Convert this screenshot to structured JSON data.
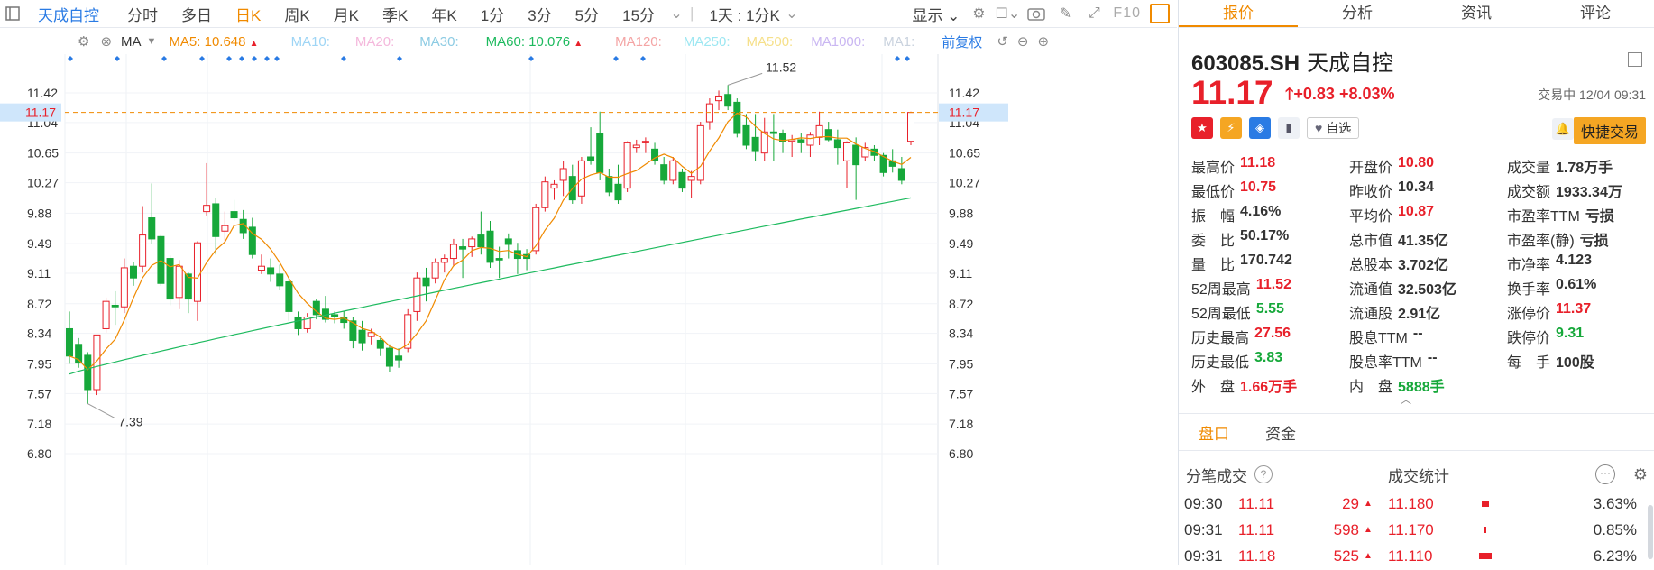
{
  "toolbar": {
    "stock_name": "天成自控",
    "periods": [
      "分时",
      "多日",
      "日K",
      "周K",
      "月K",
      "季K",
      "年K",
      "1分",
      "3分",
      "5分",
      "15分"
    ],
    "active_period": "日K",
    "combo": "1天 : 1分K",
    "display": "显示",
    "f10": "F10"
  },
  "ma_bar": {
    "ma_label": "MA",
    "ma5": "MA5: 10.648",
    "ma10": "MA10:",
    "ma20": "MA20:",
    "ma30": "MA30:",
    "ma60": "MA60: 10.076",
    "ma120": "MA120:",
    "ma250": "MA250:",
    "ma500": "MA500:",
    "ma1000": "MA1000:",
    "ma1": "MA1:",
    "adjust": "前复权"
  },
  "chart": {
    "y_ticks": [
      "11.42",
      "11.04",
      "10.65",
      "10.27",
      "9.88",
      "9.49",
      "9.11",
      "8.72",
      "8.34",
      "7.95",
      "7.57",
      "7.18",
      "6.80"
    ],
    "current_price": "11.17",
    "high_label": "11.52",
    "low_label": "7.39",
    "ylim": [
      6.8,
      11.42
    ],
    "colors": {
      "up": "#e8202a",
      "down": "#16a83a",
      "ma5": "#f08a00",
      "ma60": "#1dba5e",
      "dash": "#f08a00",
      "marker": "#2a7be4"
    }
  },
  "chart_data": {
    "type": "candlestick",
    "ylim": [
      6.8,
      11.42
    ],
    "candles": [
      {
        "o": 8.4,
        "h": 8.62,
        "l": 7.95,
        "c": 8.05
      },
      {
        "o": 8.2,
        "h": 8.28,
        "l": 7.9,
        "c": 7.96
      },
      {
        "o": 8.06,
        "h": 8.1,
        "l": 7.44,
        "c": 7.62
      },
      {
        "o": 7.62,
        "h": 8.32,
        "l": 7.55,
        "c": 8.32
      },
      {
        "o": 8.4,
        "h": 8.8,
        "l": 8.35,
        "c": 8.75
      },
      {
        "o": 8.7,
        "h": 8.88,
        "l": 8.45,
        "c": 8.68
      },
      {
        "o": 8.68,
        "h": 9.3,
        "l": 8.6,
        "c": 9.18
      },
      {
        "o": 9.2,
        "h": 9.26,
        "l": 8.95,
        "c": 9.05
      },
      {
        "o": 9.2,
        "h": 9.97,
        "l": 9.12,
        "c": 9.6
      },
      {
        "o": 9.82,
        "h": 10.26,
        "l": 9.48,
        "c": 9.55
      },
      {
        "o": 9.58,
        "h": 9.6,
        "l": 8.95,
        "c": 8.98
      },
      {
        "o": 9.3,
        "h": 9.34,
        "l": 8.7,
        "c": 8.78
      },
      {
        "o": 8.8,
        "h": 9.28,
        "l": 8.65,
        "c": 9.2
      },
      {
        "o": 9.1,
        "h": 9.12,
        "l": 8.6,
        "c": 8.78
      },
      {
        "o": 8.75,
        "h": 9.52,
        "l": 8.5,
        "c": 9.5
      },
      {
        "o": 9.9,
        "h": 10.52,
        "l": 9.85,
        "c": 9.98
      },
      {
        "o": 10.0,
        "h": 10.08,
        "l": 9.35,
        "c": 9.58
      },
      {
        "o": 9.65,
        "h": 9.9,
        "l": 9.5,
        "c": 9.72
      },
      {
        "o": 9.9,
        "h": 10.05,
        "l": 9.78,
        "c": 9.82
      },
      {
        "o": 9.8,
        "h": 9.92,
        "l": 9.55,
        "c": 9.63
      },
      {
        "o": 9.7,
        "h": 9.82,
        "l": 9.3,
        "c": 9.35
      },
      {
        "o": 9.15,
        "h": 9.35,
        "l": 9.1,
        "c": 9.2
      },
      {
        "o": 9.18,
        "h": 9.3,
        "l": 9.0,
        "c": 9.1
      },
      {
        "o": 9.1,
        "h": 9.22,
        "l": 8.9,
        "c": 8.95
      },
      {
        "o": 9.0,
        "h": 9.05,
        "l": 8.5,
        "c": 8.62
      },
      {
        "o": 8.55,
        "h": 8.62,
        "l": 8.32,
        "c": 8.4
      },
      {
        "o": 8.4,
        "h": 8.6,
        "l": 8.35,
        "c": 8.55
      },
      {
        "o": 8.75,
        "h": 8.78,
        "l": 8.52,
        "c": 8.58
      },
      {
        "o": 8.65,
        "h": 8.82,
        "l": 8.48,
        "c": 8.52
      },
      {
        "o": 8.58,
        "h": 8.62,
        "l": 8.47,
        "c": 8.55
      },
      {
        "o": 8.55,
        "h": 8.62,
        "l": 8.4,
        "c": 8.48
      },
      {
        "o": 8.5,
        "h": 8.55,
        "l": 8.15,
        "c": 8.25
      },
      {
        "o": 8.38,
        "h": 8.5,
        "l": 8.12,
        "c": 8.22
      },
      {
        "o": 8.3,
        "h": 8.4,
        "l": 8.2,
        "c": 8.35
      },
      {
        "o": 8.25,
        "h": 8.28,
        "l": 8.05,
        "c": 8.15
      },
      {
        "o": 8.15,
        "h": 8.2,
        "l": 7.85,
        "c": 7.92
      },
      {
        "o": 8.05,
        "h": 8.15,
        "l": 7.9,
        "c": 8.0
      },
      {
        "o": 8.15,
        "h": 8.65,
        "l": 8.1,
        "c": 8.58
      },
      {
        "o": 8.62,
        "h": 9.12,
        "l": 8.5,
        "c": 9.05
      },
      {
        "o": 9.05,
        "h": 9.18,
        "l": 8.75,
        "c": 8.95
      },
      {
        "o": 9.05,
        "h": 9.3,
        "l": 8.98,
        "c": 9.25
      },
      {
        "o": 9.25,
        "h": 9.35,
        "l": 9.12,
        "c": 9.3
      },
      {
        "o": 9.3,
        "h": 9.55,
        "l": 9.2,
        "c": 9.48
      },
      {
        "o": 9.45,
        "h": 9.55,
        "l": 9.05,
        "c": 9.42
      },
      {
        "o": 9.45,
        "h": 9.58,
        "l": 9.32,
        "c": 9.55
      },
      {
        "o": 9.6,
        "h": 9.9,
        "l": 9.35,
        "c": 9.45
      },
      {
        "o": 9.65,
        "h": 9.78,
        "l": 9.18,
        "c": 9.25
      },
      {
        "o": 9.3,
        "h": 9.45,
        "l": 9.05,
        "c": 9.28
      },
      {
        "o": 9.55,
        "h": 9.62,
        "l": 9.3,
        "c": 9.48
      },
      {
        "o": 9.4,
        "h": 9.5,
        "l": 9.1,
        "c": 9.3
      },
      {
        "o": 9.35,
        "h": 9.42,
        "l": 9.15,
        "c": 9.3
      },
      {
        "o": 9.4,
        "h": 10.0,
        "l": 9.35,
        "c": 9.95
      },
      {
        "o": 9.95,
        "h": 10.35,
        "l": 9.9,
        "c": 10.28
      },
      {
        "o": 10.2,
        "h": 10.3,
        "l": 10.05,
        "c": 10.25
      },
      {
        "o": 10.3,
        "h": 10.55,
        "l": 10.1,
        "c": 10.45
      },
      {
        "o": 10.35,
        "h": 10.5,
        "l": 10.0,
        "c": 10.05
      },
      {
        "o": 10.1,
        "h": 10.6,
        "l": 10.0,
        "c": 10.55
      },
      {
        "o": 10.6,
        "h": 10.98,
        "l": 10.5,
        "c": 10.55
      },
      {
        "o": 10.9,
        "h": 11.18,
        "l": 10.3,
        "c": 10.4
      },
      {
        "o": 10.35,
        "h": 10.45,
        "l": 10.1,
        "c": 10.15
      },
      {
        "o": 10.25,
        "h": 10.5,
        "l": 10.0,
        "c": 10.05
      },
      {
        "o": 10.2,
        "h": 10.8,
        "l": 10.15,
        "c": 10.78
      },
      {
        "o": 10.72,
        "h": 10.82,
        "l": 10.65,
        "c": 10.75
      },
      {
        "o": 10.78,
        "h": 10.85,
        "l": 10.65,
        "c": 10.8
      },
      {
        "o": 10.7,
        "h": 10.78,
        "l": 10.5,
        "c": 10.55
      },
      {
        "o": 10.5,
        "h": 10.6,
        "l": 10.25,
        "c": 10.3
      },
      {
        "o": 10.3,
        "h": 10.6,
        "l": 10.25,
        "c": 10.55
      },
      {
        "o": 10.4,
        "h": 10.45,
        "l": 10.15,
        "c": 10.2
      },
      {
        "o": 10.3,
        "h": 10.42,
        "l": 10.08,
        "c": 10.35
      },
      {
        "o": 10.3,
        "h": 11.05,
        "l": 10.25,
        "c": 11.0
      },
      {
        "o": 11.05,
        "h": 11.35,
        "l": 10.95,
        "c": 11.28
      },
      {
        "o": 11.32,
        "h": 11.45,
        "l": 11.2,
        "c": 11.38
      },
      {
        "o": 11.4,
        "h": 11.52,
        "l": 11.2,
        "c": 11.25
      },
      {
        "o": 11.3,
        "h": 11.35,
        "l": 10.85,
        "c": 10.9
      },
      {
        "o": 11.0,
        "h": 11.15,
        "l": 10.7,
        "c": 10.75
      },
      {
        "o": 10.85,
        "h": 11.15,
        "l": 10.55,
        "c": 10.68
      },
      {
        "o": 10.65,
        "h": 11.1,
        "l": 10.55,
        "c": 10.92
      },
      {
        "o": 10.92,
        "h": 11.15,
        "l": 10.55,
        "c": 10.9
      },
      {
        "o": 10.9,
        "h": 10.95,
        "l": 10.65,
        "c": 10.8
      },
      {
        "o": 10.8,
        "h": 10.88,
        "l": 10.6,
        "c": 10.82
      },
      {
        "o": 10.82,
        "h": 10.9,
        "l": 10.65,
        "c": 10.78
      },
      {
        "o": 10.75,
        "h": 10.92,
        "l": 10.6,
        "c": 10.88
      },
      {
        "o": 10.85,
        "h": 11.18,
        "l": 10.75,
        "c": 11.0
      },
      {
        "o": 10.95,
        "h": 11.05,
        "l": 10.8,
        "c": 10.82
      },
      {
        "o": 10.82,
        "h": 10.95,
        "l": 10.5,
        "c": 10.72
      },
      {
        "o": 10.55,
        "h": 10.8,
        "l": 10.2,
        "c": 10.78
      },
      {
        "o": 10.75,
        "h": 10.85,
        "l": 10.05,
        "c": 10.5
      },
      {
        "o": 10.6,
        "h": 10.78,
        "l": 10.55,
        "c": 10.72
      },
      {
        "o": 10.7,
        "h": 10.75,
        "l": 10.55,
        "c": 10.62
      },
      {
        "o": 10.62,
        "h": 10.65,
        "l": 10.35,
        "c": 10.4
      },
      {
        "o": 10.55,
        "h": 10.7,
        "l": 10.4,
        "c": 10.48
      },
      {
        "o": 10.45,
        "h": 10.6,
        "l": 10.25,
        "c": 10.3
      },
      {
        "o": 10.8,
        "h": 11.18,
        "l": 10.75,
        "c": 11.17
      }
    ],
    "ma60_start": 7.82,
    "ma60_end": 10.076
  },
  "panel": {
    "tabs": [
      "报价",
      "分析",
      "资讯",
      "评论"
    ],
    "active_tab": "报价",
    "code": "603085.SH",
    "name": "天成自控",
    "price": "11.17",
    "change": "+0.83",
    "change_pct": "+8.03%",
    "status": "交易中 12/04 09:31",
    "watch": "自选",
    "quick_trade": "快捷交易",
    "fields": [
      [
        [
          "最高价",
          "11.18",
          "red"
        ],
        [
          "开盘价",
          "10.80",
          "red"
        ],
        [
          "成交量",
          "1.78万手",
          "blk"
        ]
      ],
      [
        [
          "最低价",
          "10.75",
          "red"
        ],
        [
          "昨收价",
          "10.34",
          "blk"
        ],
        [
          "成交额",
          "1933.34万",
          "blk"
        ]
      ],
      [
        [
          "振　幅",
          "4.16%",
          "blk"
        ],
        [
          "平均价",
          "10.87",
          "red"
        ],
        [
          "市盈率TTM",
          "亏损",
          "blk"
        ]
      ],
      [
        [
          "委　比",
          "50.17%",
          "blk"
        ],
        [
          "总市值",
          "41.35亿",
          "blk"
        ],
        [
          "市盈率(静)",
          "亏损",
          "blk"
        ]
      ],
      [
        [
          "量　比",
          "170.742",
          "blk"
        ],
        [
          "总股本",
          "3.702亿",
          "blk"
        ],
        [
          "市净率",
          "4.123",
          "blk"
        ]
      ],
      [
        [
          "52周最高",
          "11.52",
          "red"
        ],
        [
          "流通值",
          "32.503亿",
          "blk"
        ],
        [
          "换手率",
          "0.61%",
          "blk"
        ]
      ],
      [
        [
          "52周最低",
          "5.55",
          "green"
        ],
        [
          "流通股",
          "2.91亿",
          "blk"
        ],
        [
          "涨停价",
          "11.37",
          "red"
        ]
      ],
      [
        [
          "历史最高",
          "27.56",
          "red"
        ],
        [
          "股息TTM",
          "--",
          "blk"
        ],
        [
          "跌停价",
          "9.31",
          "green"
        ]
      ],
      [
        [
          "历史最低",
          "3.83",
          "green"
        ],
        [
          "股息率TTM",
          "--",
          "blk"
        ],
        [
          "每　手",
          "100股",
          "blk"
        ]
      ],
      [
        [
          "外　盘",
          "1.66万手",
          "red"
        ],
        [
          "内　盘",
          "5888手",
          "green"
        ],
        [
          "",
          "",
          ""
        ]
      ]
    ],
    "sub_tabs": [
      "盘口",
      "资金"
    ],
    "active_sub_tab": "盘口",
    "trades_title": "分笔成交",
    "stats_title": "成交统计",
    "trades": [
      {
        "time": "09:30",
        "price": "11.11",
        "vol": "29"
      },
      {
        "time": "09:31",
        "price": "11.11",
        "vol": "598"
      },
      {
        "time": "09:31",
        "price": "11.18",
        "vol": "525"
      }
    ],
    "stats": [
      {
        "price": "11.180",
        "pct": "3.63%"
      },
      {
        "price": "11.170",
        "pct": "0.85%"
      },
      {
        "price": "11.110",
        "pct": "6.23%"
      }
    ]
  }
}
